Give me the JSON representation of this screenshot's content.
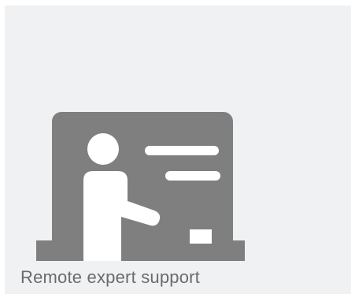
{
  "tile": {
    "label": "Remote expert support",
    "icon": "presenter-at-whiteboard-icon",
    "colors": {
      "background": "#f0f1f3",
      "icon": "#7f7f7f",
      "icon_highlight": "#ffffff",
      "label": "#6b6b6b"
    }
  }
}
